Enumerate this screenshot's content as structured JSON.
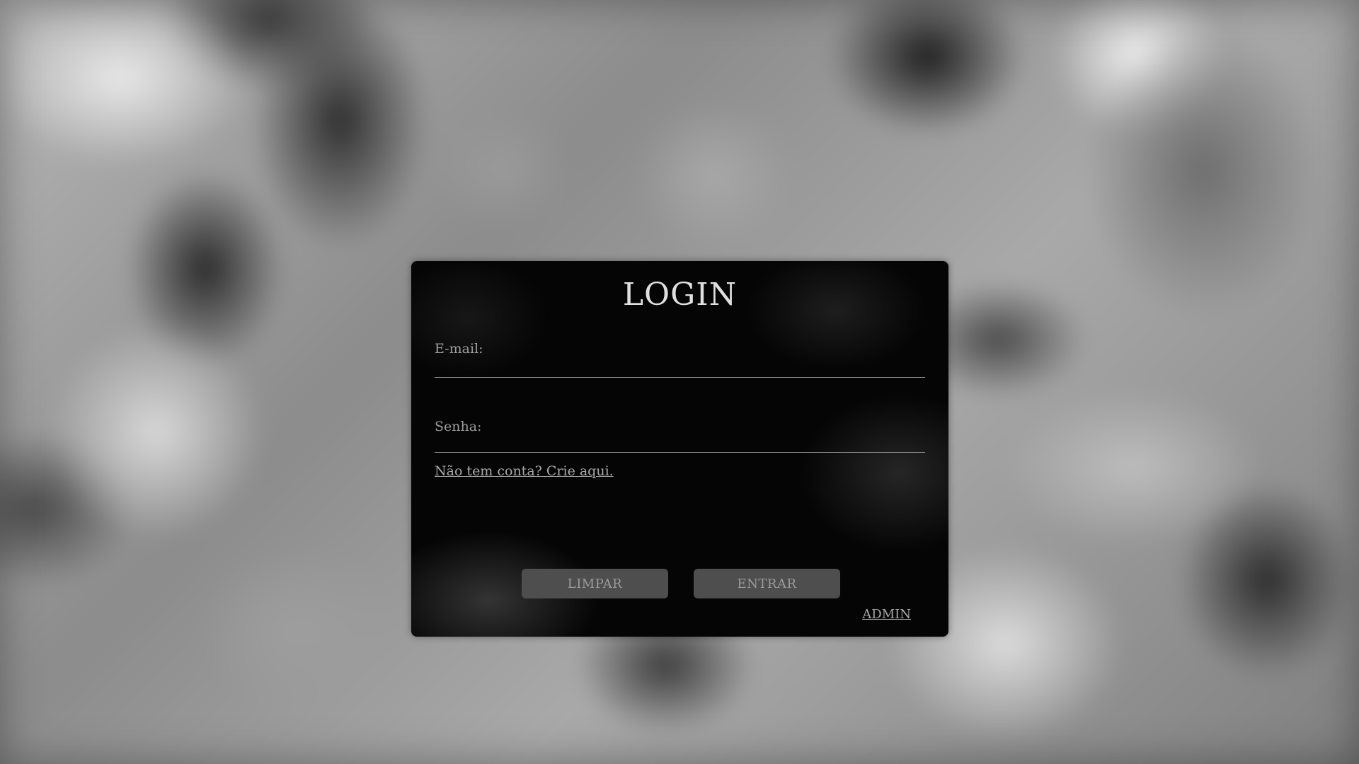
{
  "login": {
    "title": "LOGIN",
    "email_label": "E-mail:",
    "email_value": "",
    "password_label": "Senha:",
    "password_value": "",
    "signup_link": "Não tem conta? Crie aqui.",
    "clear_button": "LIMPAR",
    "submit_button": "ENTRAR",
    "admin_link": "ADMIN"
  },
  "background": {
    "description_icon": "auto-parts-background-image"
  },
  "colors": {
    "card_background": "#050505",
    "button_background": "#4e4e4e",
    "text_muted": "#9c9c9c",
    "title_text": "#e0e0e0"
  }
}
